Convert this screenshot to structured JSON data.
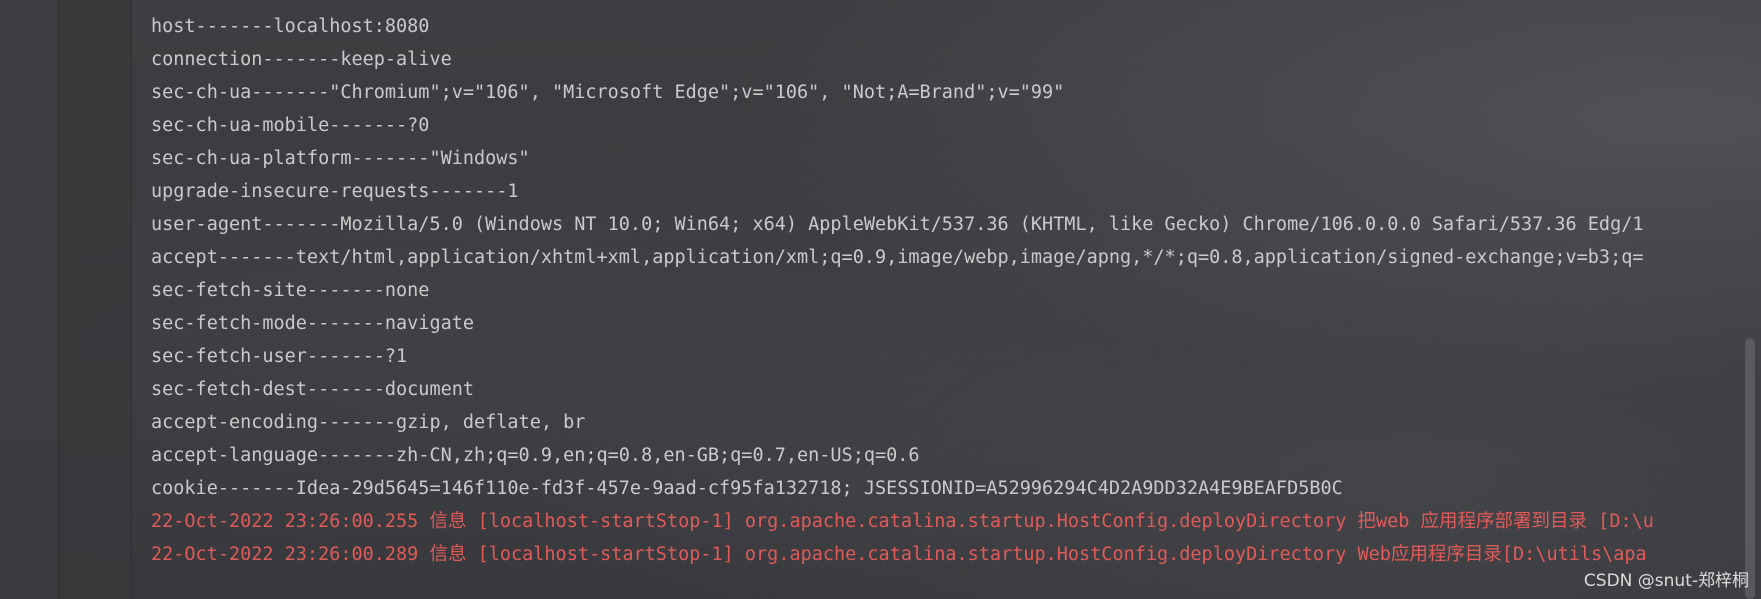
{
  "console": {
    "lines": [
      {
        "text": "host-------localhost:8080",
        "kind": "info"
      },
      {
        "text": "connection-------keep-alive",
        "kind": "info"
      },
      {
        "text": "sec-ch-ua-------\"Chromium\";v=\"106\", \"Microsoft Edge\";v=\"106\", \"Not;A=Brand\";v=\"99\"",
        "kind": "info"
      },
      {
        "text": "sec-ch-ua-mobile-------?0",
        "kind": "info"
      },
      {
        "text": "sec-ch-ua-platform-------\"Windows\"",
        "kind": "info"
      },
      {
        "text": "upgrade-insecure-requests-------1",
        "kind": "info"
      },
      {
        "text": "user-agent-------Mozilla/5.0 (Windows NT 10.0; Win64; x64) AppleWebKit/537.36 (KHTML, like Gecko) Chrome/106.0.0.0 Safari/537.36 Edg/1",
        "kind": "info"
      },
      {
        "text": "accept-------text/html,application/xhtml+xml,application/xml;q=0.9,image/webp,image/apng,*/*;q=0.8,application/signed-exchange;v=b3;q=",
        "kind": "info"
      },
      {
        "text": "sec-fetch-site-------none",
        "kind": "info"
      },
      {
        "text": "sec-fetch-mode-------navigate",
        "kind": "info"
      },
      {
        "text": "sec-fetch-user-------?1",
        "kind": "info"
      },
      {
        "text": "sec-fetch-dest-------document",
        "kind": "info"
      },
      {
        "text": "accept-encoding-------gzip, deflate, br",
        "kind": "info"
      },
      {
        "text": "accept-language-------zh-CN,zh;q=0.9,en;q=0.8,en-GB;q=0.7,en-US;q=0.6",
        "kind": "info"
      },
      {
        "text": "cookie-------Idea-29d5645=146f110e-fd3f-457e-9aad-cf95fa132718; JSESSIONID=A52996294C4D2A9DD32A4E9BEAFD5B0C",
        "kind": "info"
      },
      {
        "text": "22-Oct-2022 23:26:00.255 信息 [localhost-startStop-1] org.apache.catalina.startup.HostConfig.deployDirectory 把web 应用程序部署到目录 [D:\\u",
        "kind": "error"
      },
      {
        "text": "22-Oct-2022 23:26:00.289 信息 [localhost-startStop-1] org.apache.catalina.startup.HostConfig.deployDirectory Web应用程序目录[D:\\utils\\apa",
        "kind": "error"
      }
    ]
  },
  "watermark": "CSDN @snut-郑梓桐",
  "colors": {
    "background": "#3a3b3e",
    "text": "#c9cacc",
    "error": "#e05a5a"
  }
}
